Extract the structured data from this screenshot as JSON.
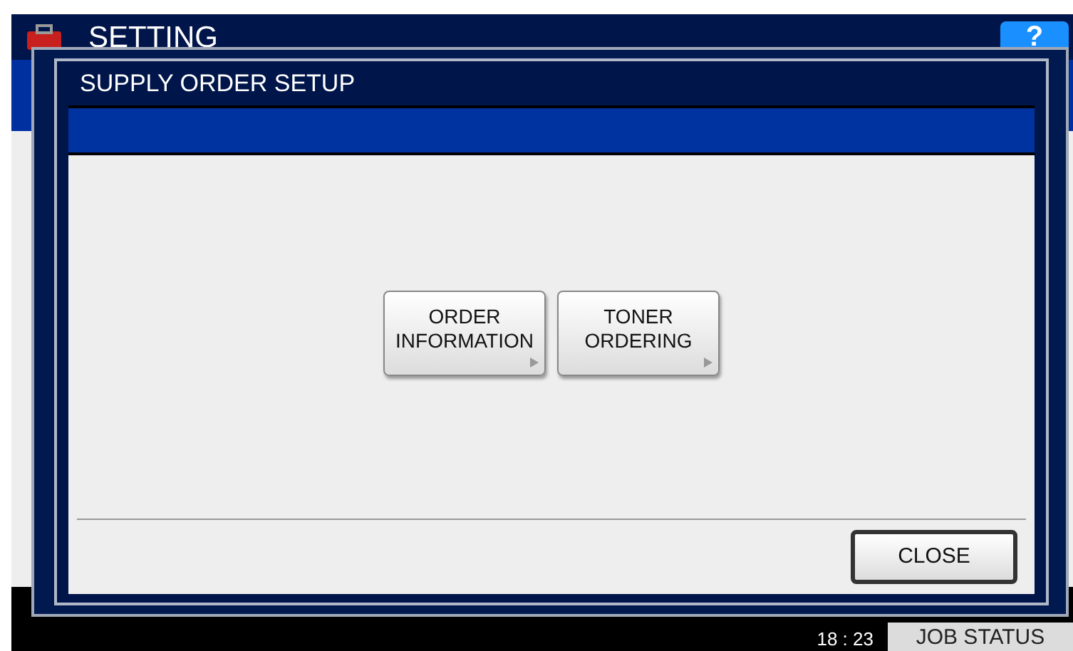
{
  "header": {
    "title": "SETTING",
    "help": "?"
  },
  "dialog": {
    "title": "SUPPLY ORDER SETUP",
    "options": [
      {
        "label": "ORDER INFORMATION"
      },
      {
        "label": "TONER ORDERING"
      }
    ],
    "close": "CLOSE"
  },
  "status_bar": {
    "time": "18 : 23",
    "job_status": "JOB STATUS"
  }
}
